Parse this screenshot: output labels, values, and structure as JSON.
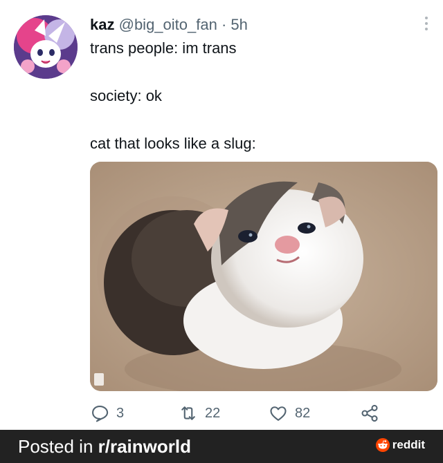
{
  "tweet": {
    "display_name": "kaz",
    "handle": "@big_oito_fan",
    "separator": "·",
    "time": "5h",
    "lines": [
      "trans people: im trans",
      "society: ok",
      "cat that looks like a slug:"
    ],
    "media_alt": "",
    "counts": {
      "replies": "3",
      "retweets": "22",
      "likes": "82"
    }
  },
  "footer": {
    "posted_prefix": "Posted in ",
    "subreddit": "r/rainworld",
    "brand": "reddit"
  },
  "colors": {
    "text": "#0f1419",
    "muted": "#536471",
    "footer_bg": "#222222",
    "reddit_orange": "#ff4500"
  },
  "icons": [
    "more-vertical-icon",
    "reply-icon",
    "retweet-icon",
    "like-icon",
    "share-icon",
    "reddit-alien-icon"
  ]
}
